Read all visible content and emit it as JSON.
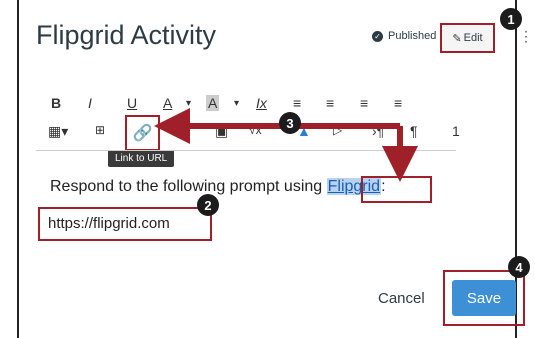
{
  "header": {
    "title": "Flipgrid Activity",
    "published_label": "Published",
    "edit_label": "Edit"
  },
  "toolbar": {
    "row1": [
      "B",
      "I",
      "U",
      "A",
      "▾",
      "A",
      "▾",
      "Ix",
      "≡",
      "≡",
      "≡",
      "≡"
    ],
    "tooltip": "Link to URL",
    "row2_end": "1"
  },
  "editor": {
    "line1_prefix": "Respond to the following prompt using ",
    "line1_link": "Flipgrid",
    "line1_suffix": ":",
    "url_text": "https://flipgrid.com"
  },
  "footer": {
    "cancel_label": "Cancel",
    "save_label": "Save"
  },
  "badges": [
    "1",
    "2",
    "3",
    "4"
  ],
  "colors": {
    "annotation": "#a0202a",
    "save": "#3d8fd6",
    "highlight": "#b8d3f0"
  }
}
